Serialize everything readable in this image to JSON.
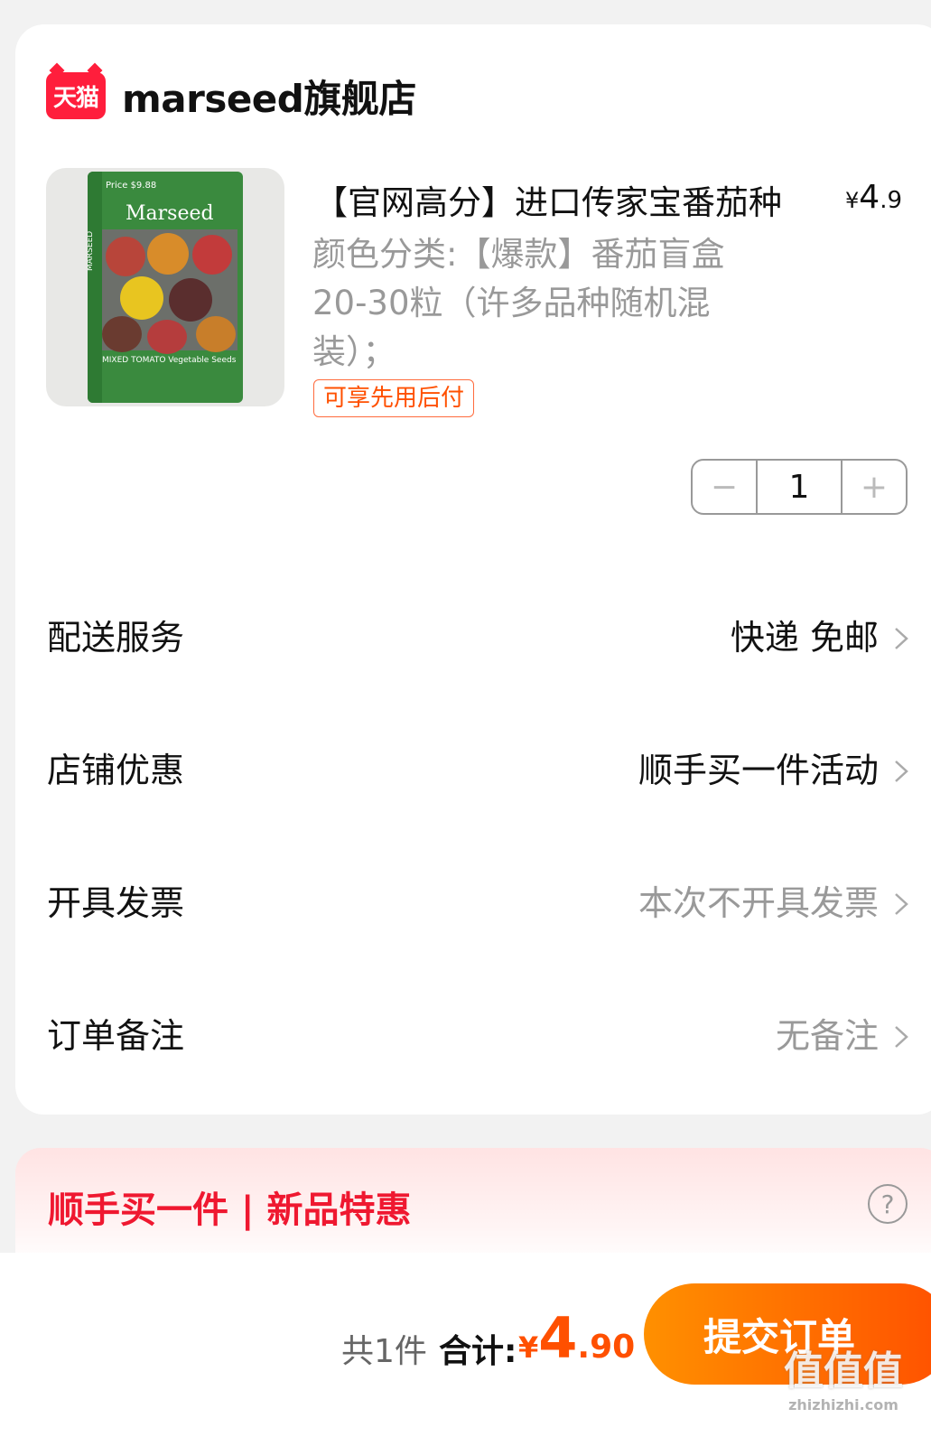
{
  "shop": {
    "logo_text": "天猫",
    "name": "marseed旗舰店"
  },
  "product": {
    "title": "【官网高分】进口传家宝番茄种",
    "price": {
      "symbol": "¥",
      "integer": "4",
      "decimal": ".9"
    },
    "sku": "颜色分类:【爆款】番茄盲盒20-30粒（许多品种随机混装）；",
    "bnpl_badge": "可享先用后付",
    "quantity": "1",
    "minus": "−",
    "plus": "+",
    "image": {
      "brand": "Marseed",
      "side": "MARSEED",
      "price_tag": "Price $9.88",
      "label": "MIXED TOMATO Vegetable Seeds"
    }
  },
  "rows": {
    "delivery": {
      "label": "配送服务",
      "value": "快递 免邮"
    },
    "discount": {
      "label": "店铺优惠",
      "value": "顺手买一件活动"
    },
    "invoice": {
      "label": "开具发票",
      "value": "本次不开具发票"
    },
    "note": {
      "label": "订单备注",
      "value": "无备注"
    }
  },
  "promo": {
    "text": "顺手买一件 | 新品特惠",
    "help": "?"
  },
  "footer": {
    "count": "共1件",
    "total_label": "合计:",
    "total": {
      "symbol": "¥",
      "integer": "4",
      "decimal": ".90"
    },
    "submit": "提交订单"
  },
  "watermark": {
    "main": "值值值",
    "sub": "zhizhizhi.com"
  },
  "colors": {
    "accent": "#ff5000",
    "promo_red": "#ef1830",
    "tmall_red": "#ff1e3c"
  }
}
